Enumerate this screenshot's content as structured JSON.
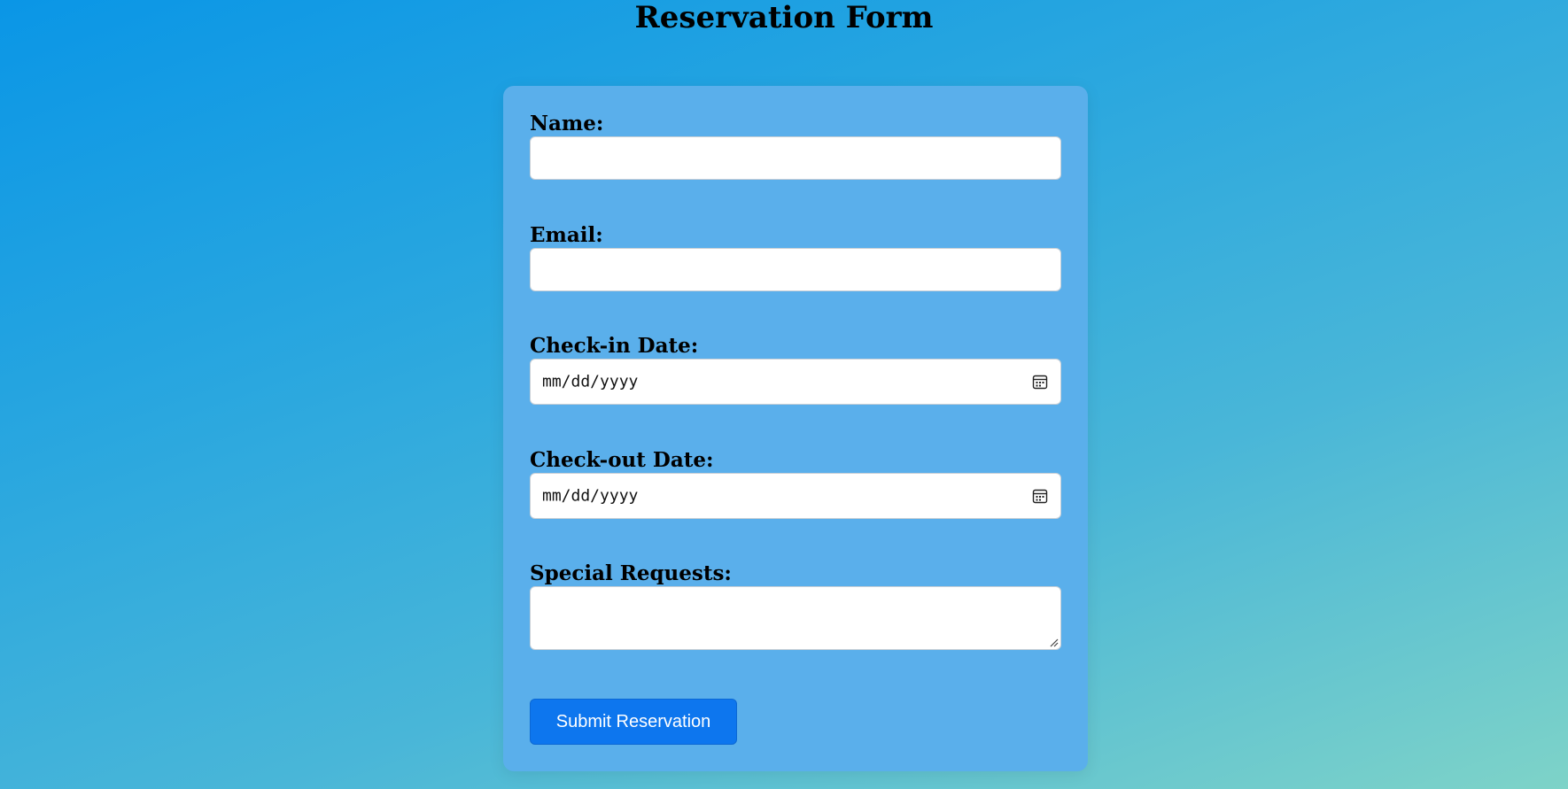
{
  "page": {
    "title": "Reservation Form"
  },
  "form": {
    "name_label": "Name:",
    "name_value": "",
    "email_label": "Email:",
    "email_value": "",
    "checkin_label": "Check-in Date:",
    "checkin_placeholder": "mm/dd/yyyy",
    "checkout_label": "Check-out Date:",
    "checkout_placeholder": "mm/dd/yyyy",
    "requests_label": "Special Requests:",
    "requests_value": "",
    "submit_label": "Submit Reservation"
  },
  "icons": {
    "date_picker": "calendar-icon",
    "textarea_resize": "resize-handle-icon"
  },
  "colors": {
    "card_background": "#5aafeb",
    "submit_button": "#0d76ee",
    "gradient_start": "#0a96e6",
    "gradient_end": "#7ed3c8"
  }
}
